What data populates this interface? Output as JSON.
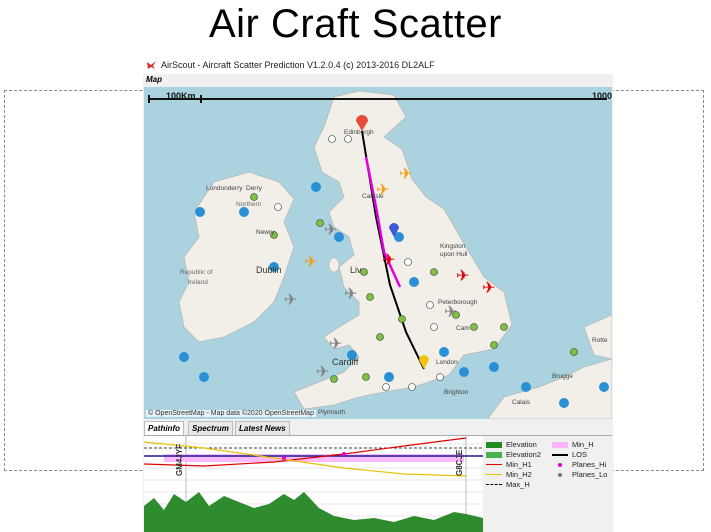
{
  "slide": {
    "title": "Air Craft Scatter"
  },
  "window": {
    "title": "AirScout - Aircraft Scatter Prediction V1.2.0.4 (c) 2013-2016 DL2ALF"
  },
  "menu": {
    "map_label": "Map"
  },
  "map": {
    "scale_left": "100Km",
    "scale_right": "1000",
    "attribution": "© OpenStreetMap - Map data ©2020 OpenStreetMap",
    "places": {
      "edinburgh": "Edinburgh",
      "londonderry": "Londonderry",
      "derry": "Derry",
      "northern": "Northern",
      "carlisle": "Carlisle",
      "newry": "Newry",
      "dublin": "Dublin",
      "republic": "Republic of",
      "ireland": "Ireland",
      "kingston": "Kingston",
      "upon_hull": "upon Hull",
      "liverpool": "Liv",
      "peterborough": "Peterborough",
      "cambridge": "Cam",
      "cardiff": "Cardiff",
      "london": "London",
      "brighton": "Brighton",
      "plymouth": "Plymouth",
      "calais": "Calais",
      "rotterdam": "Rotte",
      "brugge": "Brugge"
    },
    "colors": {
      "sea": "#aad3df",
      "land": "#f2efe9",
      "path": "#000000",
      "los": "#e000e0"
    }
  },
  "tabs": [
    {
      "label": "Pathinfo"
    },
    {
      "label": "Spectrum"
    },
    {
      "label": "Latest News"
    }
  ],
  "chart": {
    "left_call": "GM4JYF",
    "right_call": "G8CJE"
  },
  "legend": [
    {
      "label": "Elevation",
      "color": "#228b22",
      "kind": "fill"
    },
    {
      "label": "Min_H",
      "color": "#ffb3ff",
      "kind": "fill"
    },
    {
      "label": "Elevation2",
      "color": "#4caf50",
      "kind": "fill"
    },
    {
      "label": "LOS",
      "color": "#000000",
      "kind": "line"
    },
    {
      "label": "Min_H1",
      "color": "#e00000",
      "kind": "line"
    },
    {
      "label": "Planes_Hi",
      "color": "#e000e0",
      "kind": "dot"
    },
    {
      "label": "Min_H2",
      "color": "#e6c200",
      "kind": "line"
    },
    {
      "label": "Planes_Lo",
      "color": "#777777",
      "kind": "dot"
    },
    {
      "label": "Max_H",
      "color": "#000000",
      "kind": "dash"
    }
  ]
}
